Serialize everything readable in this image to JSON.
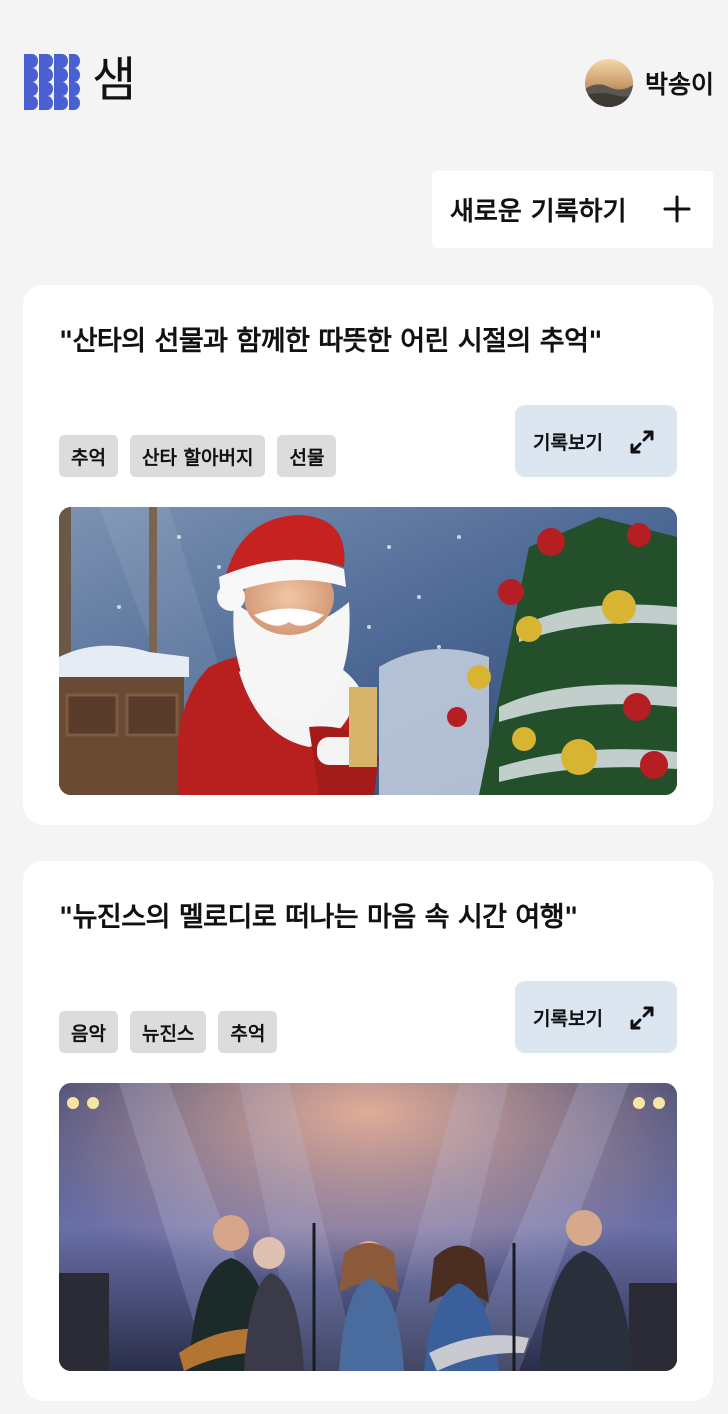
{
  "header": {
    "logo_text": "샘",
    "user": {
      "name": "박송이",
      "avatar_icon": "avatar-landscape-icon"
    }
  },
  "actions": {
    "new_record_label": "새로운 기록하기",
    "new_record_icon": "plus-icon"
  },
  "records": [
    {
      "title": "\"산타의 선물과 함께한 따뜻한 어린 시절의 추억\"",
      "tags": [
        "추억",
        "산타 할아버지",
        "선물"
      ],
      "view_label": "기록보기",
      "view_icon": "expand-icon",
      "image_icon": "santa-christmas-tree-image"
    },
    {
      "title": "\"뉴진스의 멜로디로 떠나는 마음 속 시간 여행\"",
      "tags": [
        "음악",
        "뉴진스",
        "추억"
      ],
      "view_label": "기록보기",
      "view_icon": "expand-icon",
      "image_icon": "band-concert-stage-image"
    }
  ],
  "colors": {
    "background": "#f4f4f4",
    "card": "#ffffff",
    "logo_blue": "#4a5fd1",
    "tag_bg": "#dcdcdc",
    "view_button_bg": "#dbe6f1"
  }
}
